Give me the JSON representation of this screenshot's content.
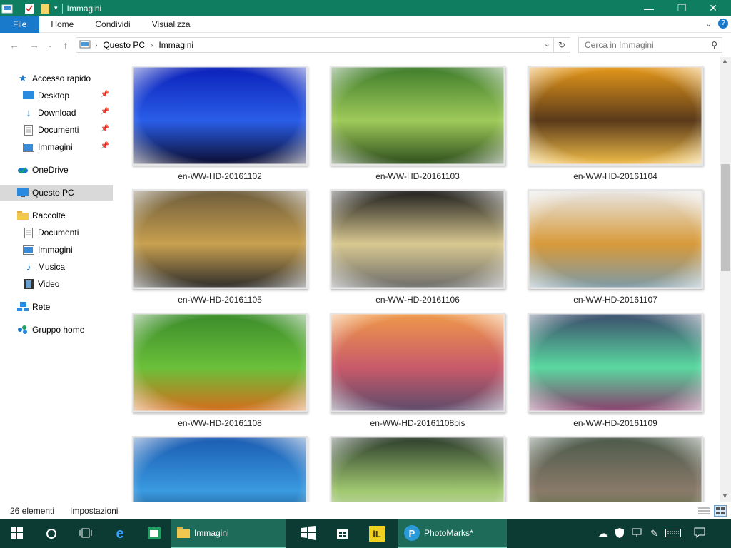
{
  "window": {
    "title": "Immagini",
    "minimize": "—",
    "maximize": "❐",
    "close": "✕"
  },
  "ribbon": {
    "tabs": [
      "File",
      "Home",
      "Condividi",
      "Visualizza"
    ],
    "help": "?"
  },
  "address": {
    "path": [
      "Questo PC",
      "Immagini"
    ],
    "search_placeholder": "Cerca in Immagini"
  },
  "nav": {
    "items": [
      {
        "label": "Accesso rapido",
        "icon": "star-icon"
      },
      {
        "label": "Desktop",
        "icon": "desktop-icon",
        "pinned": true
      },
      {
        "label": "Download",
        "icon": "download-icon",
        "pinned": true
      },
      {
        "label": "Documenti",
        "icon": "document-icon",
        "pinned": true
      },
      {
        "label": "Immagini",
        "icon": "pictures-icon",
        "pinned": true
      },
      {
        "label": "OneDrive",
        "icon": "cloud-icon"
      },
      {
        "label": "Questo PC",
        "icon": "computer-icon",
        "selected": true
      },
      {
        "label": "Raccolte",
        "icon": "folder-icon"
      },
      {
        "label": "Documenti",
        "icon": "document-icon"
      },
      {
        "label": "Immagini",
        "icon": "pictures-icon"
      },
      {
        "label": "Musica",
        "icon": "music-icon"
      },
      {
        "label": "Video",
        "icon": "video-icon"
      },
      {
        "label": "Rete",
        "icon": "network-icon"
      },
      {
        "label": "Gruppo home",
        "icon": "homegroup-icon"
      }
    ]
  },
  "files": [
    {
      "name": "en-WW-HD-20161102",
      "colors": [
        "#0a1fb8",
        "#2a5ee8",
        "#0a0a2a"
      ]
    },
    {
      "name": "en-WW-HD-20161103",
      "colors": [
        "#3c7a2a",
        "#9fca5a",
        "#2a4a1a"
      ]
    },
    {
      "name": "en-WW-HD-20161104",
      "colors": [
        "#e89a1a",
        "#5a3a1a",
        "#f4c04a"
      ]
    },
    {
      "name": "en-WW-HD-20161105",
      "colors": [
        "#6a5a3a",
        "#c8a050",
        "#2a2a2a"
      ]
    },
    {
      "name": "en-WW-HD-20161106",
      "colors": [
        "#1a1a1a",
        "#d8c890",
        "#6a6a6a"
      ]
    },
    {
      "name": "en-WW-HD-20161107",
      "colors": [
        "#e8e8e8",
        "#d89a3a",
        "#7a9aaa"
      ]
    },
    {
      "name": "en-WW-HD-20161108",
      "colors": [
        "#3a8a2a",
        "#6ac03a",
        "#d86a1a"
      ]
    },
    {
      "name": "en-WW-HD-20161108bis",
      "colors": [
        "#f09a4a",
        "#c85a6a",
        "#5a4a6a"
      ]
    },
    {
      "name": "en-WW-HD-20161109",
      "colors": [
        "#3a4a6a",
        "#5ad8a0",
        "#8a3a6a"
      ]
    },
    {
      "name": "",
      "colors": [
        "#1a5ab0",
        "#3a9ae0",
        "#0a2a4a"
      ]
    },
    {
      "name": "",
      "colors": [
        "#2a3a2a",
        "#a0c870",
        "#e0e0e0"
      ]
    },
    {
      "name": "",
      "colors": [
        "#4a5a4a",
        "#8a7a6a",
        "#3a6a2a"
      ]
    }
  ],
  "status": {
    "count": "26 elementi",
    "settings": "Impostazioni"
  },
  "taskbar": {
    "explorer_label": "Immagini",
    "photomarks_label": "PhotoMarks*"
  }
}
